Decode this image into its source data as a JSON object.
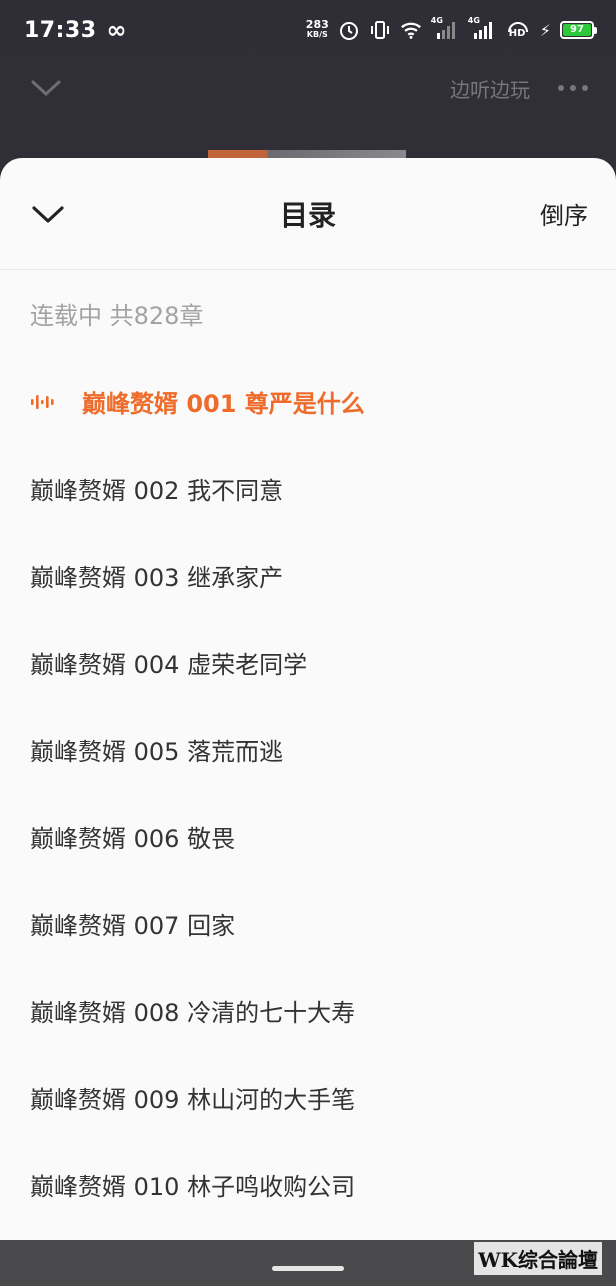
{
  "status_bar": {
    "time": "17:33",
    "infinity": "∞",
    "net_speed_value": "283",
    "net_speed_unit": "KB/S",
    "signal_label_1": "4G",
    "signal_label_2": "4G",
    "hd_label": "HD",
    "battery_level": "97"
  },
  "player_header": {
    "play_while_label": "边听边玩"
  },
  "sheet": {
    "title": "目录",
    "reverse_label": "倒序",
    "serial_info": "连载中 共828章",
    "chapters": [
      {
        "label": "巅峰赘婿 001 尊严是什么",
        "active": true
      },
      {
        "label": "巅峰赘婿 002 我不同意"
      },
      {
        "label": "巅峰赘婿 003 继承家产"
      },
      {
        "label": "巅峰赘婿 004 虚荣老同学"
      },
      {
        "label": "巅峰赘婿 005 落荒而逃"
      },
      {
        "label": "巅峰赘婿 006 敬畏"
      },
      {
        "label": "巅峰赘婿 007 回家"
      },
      {
        "label": "巅峰赘婿 008 冷清的七十大寿"
      },
      {
        "label": "巅峰赘婿 009 林山河的大手笔"
      },
      {
        "label": "巅峰赘婿 010 林子鸣收购公司"
      }
    ]
  },
  "watermark": "WK综合論壇",
  "colors": {
    "accent": "#ee6b2a",
    "sheet_bg": "#fafafb",
    "battery": "#2ec93a"
  }
}
